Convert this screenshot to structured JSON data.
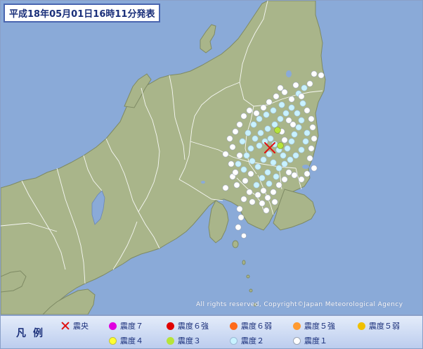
{
  "title": "平成18年05月01日16時11分発表",
  "copyright": "All rights reserved, Copyright©Japan Meteorological Agency",
  "colors": {
    "sea": "#8aaad8",
    "land": "#a9b58a",
    "border": "#ffffff",
    "lake": "#8aaad8"
  },
  "epicenter": {
    "label": "震央",
    "color": "#e01010",
    "icon": "x-cross-icon"
  },
  "legend": {
    "title": "凡例",
    "items": [
      {
        "key": "epicenter",
        "label": "震央",
        "color": "#e01010",
        "icon": "x-cross-icon"
      },
      {
        "key": "s7",
        "label": "震度７",
        "color": "#e000e0"
      },
      {
        "key": "s6p",
        "label": "震度６強",
        "color": "#e00000"
      },
      {
        "key": "s6m",
        "label": "震度６弱",
        "color": "#ff6a1a"
      },
      {
        "key": "s5p",
        "label": "震度５強",
        "color": "#ff9a30"
      },
      {
        "key": "s5m",
        "label": "震度５弱",
        "color": "#f0c000"
      },
      {
        "key": "s4",
        "label": "震度４",
        "color": "#ffff30"
      },
      {
        "key": "s3",
        "label": "震度３",
        "color": "#b6e43a"
      },
      {
        "key": "s2",
        "label": "震度２",
        "color": "#c8f2ff"
      },
      {
        "key": "s1",
        "label": "震度１",
        "color": "#ffffff"
      }
    ]
  }
}
